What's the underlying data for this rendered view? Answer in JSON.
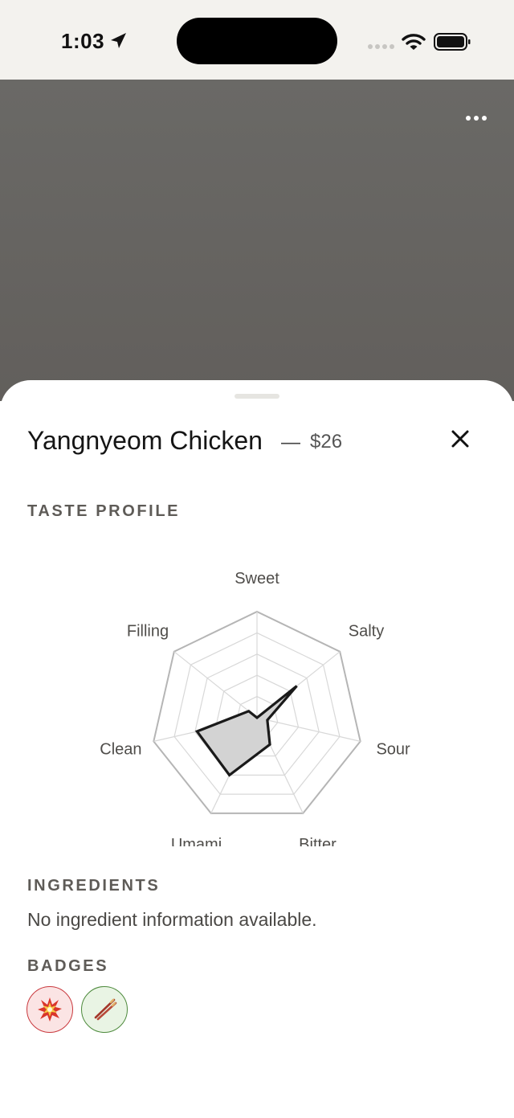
{
  "status_bar": {
    "time": "1:03",
    "icons": [
      "location-arrow-icon",
      "cellular-signal-icon",
      "wifi-icon",
      "battery-icon"
    ]
  },
  "header": {
    "more_icon": "ellipsis-icon"
  },
  "dish": {
    "name": "Yangnyeom Chicken",
    "separator": "—",
    "price": "$26",
    "close_icon": "close-icon"
  },
  "taste_profile": {
    "label": "TASTE PROFILE",
    "chart_data": {
      "type": "radar",
      "axes": [
        "Sweet",
        "Salty",
        "Sour",
        "Bitter",
        "Umami",
        "Clean",
        "Filling"
      ],
      "scale_max": 5,
      "rings": 5,
      "values": [
        0,
        2.4,
        0.5,
        1.4,
        3.0,
        2.9,
        0.5
      ],
      "fill_color": "#d3d3d3",
      "stroke_color": "#1a1a1a",
      "grid_color": "#d8d8d8"
    }
  },
  "ingredients": {
    "label": "INGREDIENTS",
    "text": "No ingredient information available."
  },
  "badges": {
    "label": "BADGES",
    "items": [
      {
        "icon": "spicy-burst-icon",
        "color": "#c9383d"
      },
      {
        "icon": "chopsticks-icon",
        "color": "#4d8a3c"
      }
    ]
  }
}
